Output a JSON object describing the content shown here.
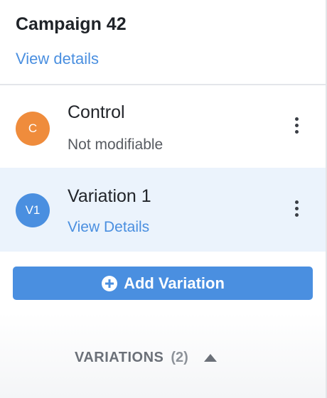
{
  "header": {
    "title": "Campaign 42",
    "view_details_label": "View details"
  },
  "variations": [
    {
      "avatar_text": "C",
      "avatar_color": "#ef8c3c",
      "name": "Control",
      "subtitle": "Not modifiable",
      "menu_icon": "kebab-menu-icon",
      "selected": false
    },
    {
      "avatar_text": "V1",
      "avatar_color": "#4a8fe0",
      "name": "Variation 1",
      "subtitle": "View Details",
      "menu_icon": "kebab-menu-icon",
      "selected": true
    }
  ],
  "add_button": {
    "label": "Add Variation",
    "icon": "plus-circle-icon"
  },
  "footer": {
    "label": "VARIATIONS",
    "count": "(2)",
    "icon": "caret-up-icon"
  },
  "colors": {
    "accent": "#4a8fe0",
    "control_avatar": "#ef8c3c",
    "selected_row_bg": "#ebf3fc"
  }
}
